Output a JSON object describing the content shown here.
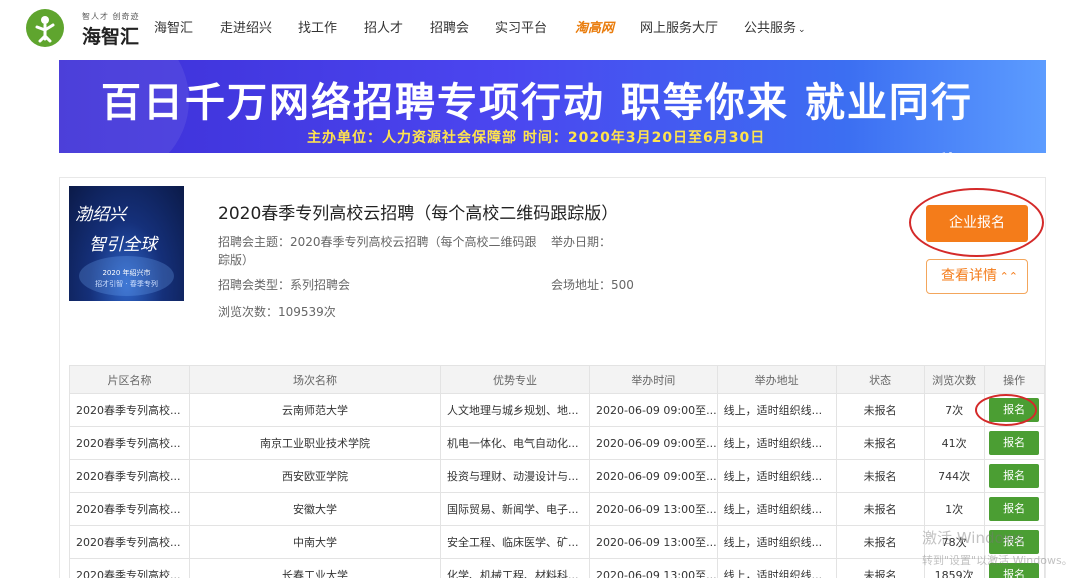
{
  "header": {
    "logo_tagline": "智人才 创奇迹",
    "logo_name": "海智汇",
    "nav": [
      {
        "label": "海智汇",
        "highlight": false
      },
      {
        "label": "走进绍兴",
        "highlight": false
      },
      {
        "label": "找工作",
        "highlight": false
      },
      {
        "label": "招人才",
        "highlight": false
      },
      {
        "label": "招聘会",
        "highlight": false
      },
      {
        "label": "实习平台",
        "highlight": false
      },
      {
        "label": "淘高网",
        "highlight": true
      },
      {
        "label": "网上服务大厅",
        "highlight": false
      },
      {
        "label": "公共服务",
        "highlight": false,
        "dropdown": true
      }
    ]
  },
  "banner": {
    "title": "百日千万网络招聘专项行动  职等你来  就业同行",
    "subtitle": "主办单位：人力资源社会保障部  时间：2020年3月20日至6月30日"
  },
  "fair": {
    "poster_line1": "渤绍兴",
    "poster_line2": "智引全球",
    "poster_line3": "2020 年绍兴市",
    "poster_line4": "招才引智 · 春季专列",
    "title": "2020春季专列高校云招聘（每个高校二维码跟踪版）",
    "theme": "招聘会主题：2020春季专列高校云招聘（每个高校二维码跟踪版）",
    "date": "举办日期：",
    "type": "招聘会类型：系列招聘会",
    "address": "会场地址：500",
    "views": "浏览次数：109539次",
    "enroll_button": "企业报名",
    "detail_button": "查看详情"
  },
  "table": {
    "headers": [
      "片区名称",
      "场次名称",
      "优势专业",
      "举办时间",
      "举办地址",
      "状态",
      "浏览次数",
      "操作"
    ],
    "rows": [
      [
        "2020春季专列高校...",
        "云南师范大学",
        "人文地理与城乡规划、地...",
        "2020-06-09 09:00至...",
        "线上，适时组织线...",
        "未报名",
        "7次",
        "报名"
      ],
      [
        "2020春季专列高校...",
        "南京工业职业技术学院",
        "机电一体化、电气自动化...",
        "2020-06-09 09:00至...",
        "线上，适时组织线...",
        "未报名",
        "41次",
        "报名"
      ],
      [
        "2020春季专列高校...",
        "西安欧亚学院",
        "投资与理财、动漫设计与...",
        "2020-06-09 09:00至...",
        "线上，适时组织线...",
        "未报名",
        "744次",
        "报名"
      ],
      [
        "2020春季专列高校...",
        "安徽大学",
        "国际贸易、新闻学、电子...",
        "2020-06-09 13:00至...",
        "线上，适时组织线...",
        "未报名",
        "1次",
        "报名"
      ],
      [
        "2020春季专列高校...",
        "中南大学",
        "安全工程、临床医学、矿...",
        "2020-06-09 13:00至...",
        "线上，适时组织线...",
        "未报名",
        "78次",
        "报名"
      ],
      [
        "2020春季专列高校...",
        "长春工业大学",
        "化学、机械工程、材料科...",
        "2020-06-09 13:00至...",
        "线上，适时组织线...",
        "未报名",
        "1859次",
        "报名"
      ]
    ]
  },
  "watermark": {
    "line1": "激活 Windows",
    "line2": "转到\"设置\"以激活 Windows。"
  },
  "colors": {
    "brand_green": "#5fa52e",
    "accent_orange": "#f47c1a",
    "action_green": "#4b9e33",
    "annotation_red": "#d42a2a"
  }
}
